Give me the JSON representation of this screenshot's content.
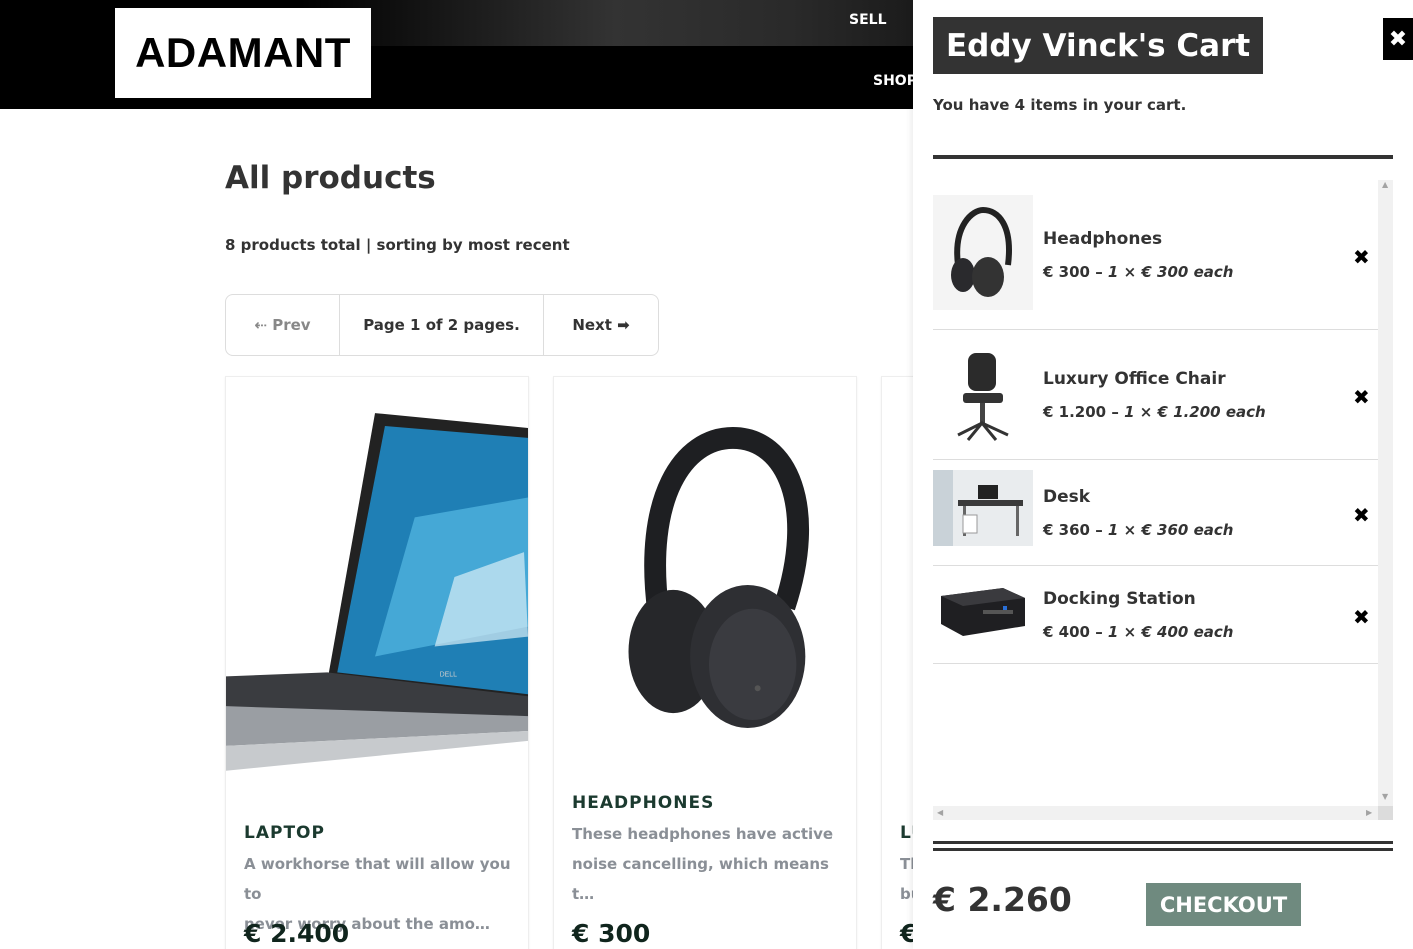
{
  "header": {
    "logo_text": "ADAMANT",
    "nav_sell": "SELL",
    "nav_shop": "SHOP"
  },
  "main": {
    "title": "All products",
    "summary": "8 products total | sorting by most recent",
    "pager": {
      "prev": "⇠ Prev",
      "info": "Page 1 of 2 pages.",
      "next": "Next ➡"
    },
    "products": [
      {
        "name": "LAPTOP",
        "description_lines": [
          "A workhorse that will allow you to",
          "never worry about the amo…"
        ],
        "price": "€ 2.400"
      },
      {
        "name": "HEADPHONES",
        "description_lines": [
          "These headphones have active",
          "noise cancelling, which means",
          "t…"
        ],
        "price": "€ 300"
      },
      {
        "name": "LU",
        "description_lines": [
          "Th",
          "bu"
        ],
        "price": "€"
      }
    ]
  },
  "cart": {
    "title": "Eddy Vinck's Cart",
    "close_icon": "✖",
    "count_text": "You have 4 items in your cart.",
    "items": [
      {
        "name": "Headphones",
        "price": "€ 300 – ",
        "detail": "1 × € 300 each",
        "remove": "✖"
      },
      {
        "name": "Luxury Office Chair",
        "price": "€ 1.200 – ",
        "detail": "1 × € 1.200 each",
        "remove": "✖"
      },
      {
        "name": "Desk",
        "price": "€ 360 – ",
        "detail": "1 × € 360 each",
        "remove": "✖"
      },
      {
        "name": "Docking Station",
        "price": "€ 400 – ",
        "detail": "1 × € 400 each",
        "remove": "✖"
      }
    ],
    "total": "€ 2.260",
    "checkout_label": "CHECKOUT"
  },
  "colors": {
    "accent": "#6f8a7f",
    "product_name": "#1b3a2f",
    "dark": "#333333"
  }
}
